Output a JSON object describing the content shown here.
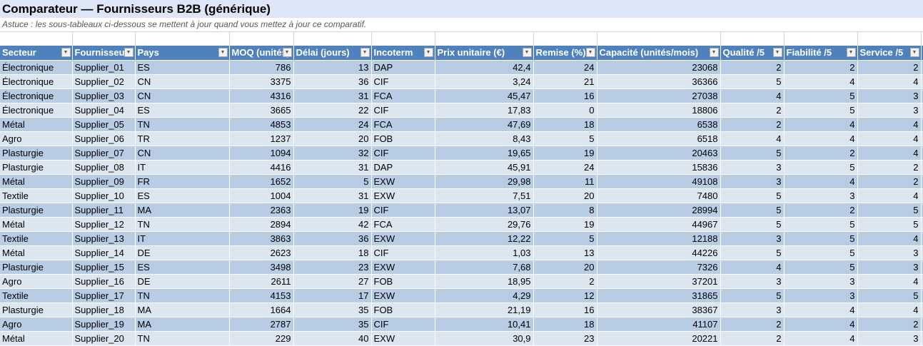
{
  "title": "Comparateur — Fournisseurs B2B (générique)",
  "subtitle": "Astuce : les sous-tableaux ci-dessous se mettent à jour quand vous mettez à jour ce comparatif.",
  "colors": {
    "header": "#4f81bd",
    "row_dark": "#b8cce4",
    "row_light": "#dce6f1",
    "title_bg": "#dce6f7"
  },
  "columns": [
    {
      "label": "Secteur",
      "align": "left"
    },
    {
      "label": "Fournisseur",
      "align": "left"
    },
    {
      "label": "Pays",
      "align": "left"
    },
    {
      "label": "MOQ (unités)",
      "align": "right"
    },
    {
      "label": "Délai (jours)",
      "align": "right"
    },
    {
      "label": "Incoterm",
      "align": "left"
    },
    {
      "label": "Prix unitaire (€)",
      "align": "right"
    },
    {
      "label": "Remise (%)",
      "align": "right"
    },
    {
      "label": "Capacité (unités/mois)",
      "align": "right"
    },
    {
      "label": "Qualité /5",
      "align": "right"
    },
    {
      "label": "Fiabilité /5",
      "align": "right"
    },
    {
      "label": "Service /5",
      "align": "right"
    }
  ],
  "rows": [
    [
      "Électronique",
      "Supplier_01",
      "ES",
      "786",
      "13",
      "DAP",
      "42,4",
      "24",
      "23068",
      "2",
      "2",
      "2"
    ],
    [
      "Électronique",
      "Supplier_02",
      "CN",
      "3375",
      "36",
      "CIF",
      "3,24",
      "21",
      "36366",
      "5",
      "4",
      "4"
    ],
    [
      "Électronique",
      "Supplier_03",
      "CN",
      "4316",
      "31",
      "FCA",
      "45,47",
      "16",
      "27038",
      "4",
      "5",
      "3"
    ],
    [
      "Électronique",
      "Supplier_04",
      "ES",
      "3665",
      "22",
      "CIF",
      "17,83",
      "0",
      "18806",
      "2",
      "5",
      "3"
    ],
    [
      "Métal",
      "Supplier_05",
      "TN",
      "4853",
      "24",
      "FCA",
      "47,69",
      "18",
      "6538",
      "2",
      "4",
      "4"
    ],
    [
      "Agro",
      "Supplier_06",
      "TR",
      "1237",
      "20",
      "FOB",
      "8,43",
      "5",
      "6518",
      "4",
      "4",
      "4"
    ],
    [
      "Plasturgie",
      "Supplier_07",
      "CN",
      "1094",
      "32",
      "CIF",
      "19,65",
      "19",
      "20463",
      "5",
      "2",
      "4"
    ],
    [
      "Plasturgie",
      "Supplier_08",
      "IT",
      "4416",
      "31",
      "DAP",
      "45,91",
      "24",
      "15836",
      "3",
      "5",
      "2"
    ],
    [
      "Métal",
      "Supplier_09",
      "FR",
      "1652",
      "5",
      "EXW",
      "29,98",
      "11",
      "49108",
      "3",
      "4",
      "2"
    ],
    [
      "Textile",
      "Supplier_10",
      "ES",
      "1004",
      "31",
      "EXW",
      "7,51",
      "20",
      "7480",
      "5",
      "3",
      "4"
    ],
    [
      "Plasturgie",
      "Supplier_11",
      "MA",
      "2363",
      "19",
      "CIF",
      "13,07",
      "8",
      "28994",
      "5",
      "2",
      "5"
    ],
    [
      "Métal",
      "Supplier_12",
      "TN",
      "2894",
      "42",
      "FCA",
      "29,76",
      "19",
      "44967",
      "5",
      "5",
      "5"
    ],
    [
      "Textile",
      "Supplier_13",
      "IT",
      "3863",
      "36",
      "EXW",
      "12,22",
      "5",
      "12188",
      "3",
      "5",
      "4"
    ],
    [
      "Métal",
      "Supplier_14",
      "DE",
      "2623",
      "18",
      "CIF",
      "1,03",
      "13",
      "44226",
      "5",
      "5",
      "3"
    ],
    [
      "Plasturgie",
      "Supplier_15",
      "ES",
      "3498",
      "23",
      "EXW",
      "7,68",
      "20",
      "7326",
      "4",
      "5",
      "3"
    ],
    [
      "Agro",
      "Supplier_16",
      "DE",
      "2611",
      "27",
      "FOB",
      "18,95",
      "2",
      "37201",
      "3",
      "3",
      "4"
    ],
    [
      "Textile",
      "Supplier_17",
      "TN",
      "4153",
      "17",
      "EXW",
      "4,29",
      "12",
      "31865",
      "5",
      "3",
      "5"
    ],
    [
      "Plasturgie",
      "Supplier_18",
      "MA",
      "1664",
      "35",
      "FOB",
      "21,19",
      "16",
      "38367",
      "3",
      "4",
      "4"
    ],
    [
      "Agro",
      "Supplier_19",
      "MA",
      "2787",
      "35",
      "CIF",
      "10,41",
      "18",
      "41107",
      "2",
      "4",
      "2"
    ],
    [
      "Métal",
      "Supplier_20",
      "TN",
      "229",
      "40",
      "EXW",
      "30,9",
      "23",
      "20221",
      "2",
      "4",
      "3"
    ]
  ]
}
